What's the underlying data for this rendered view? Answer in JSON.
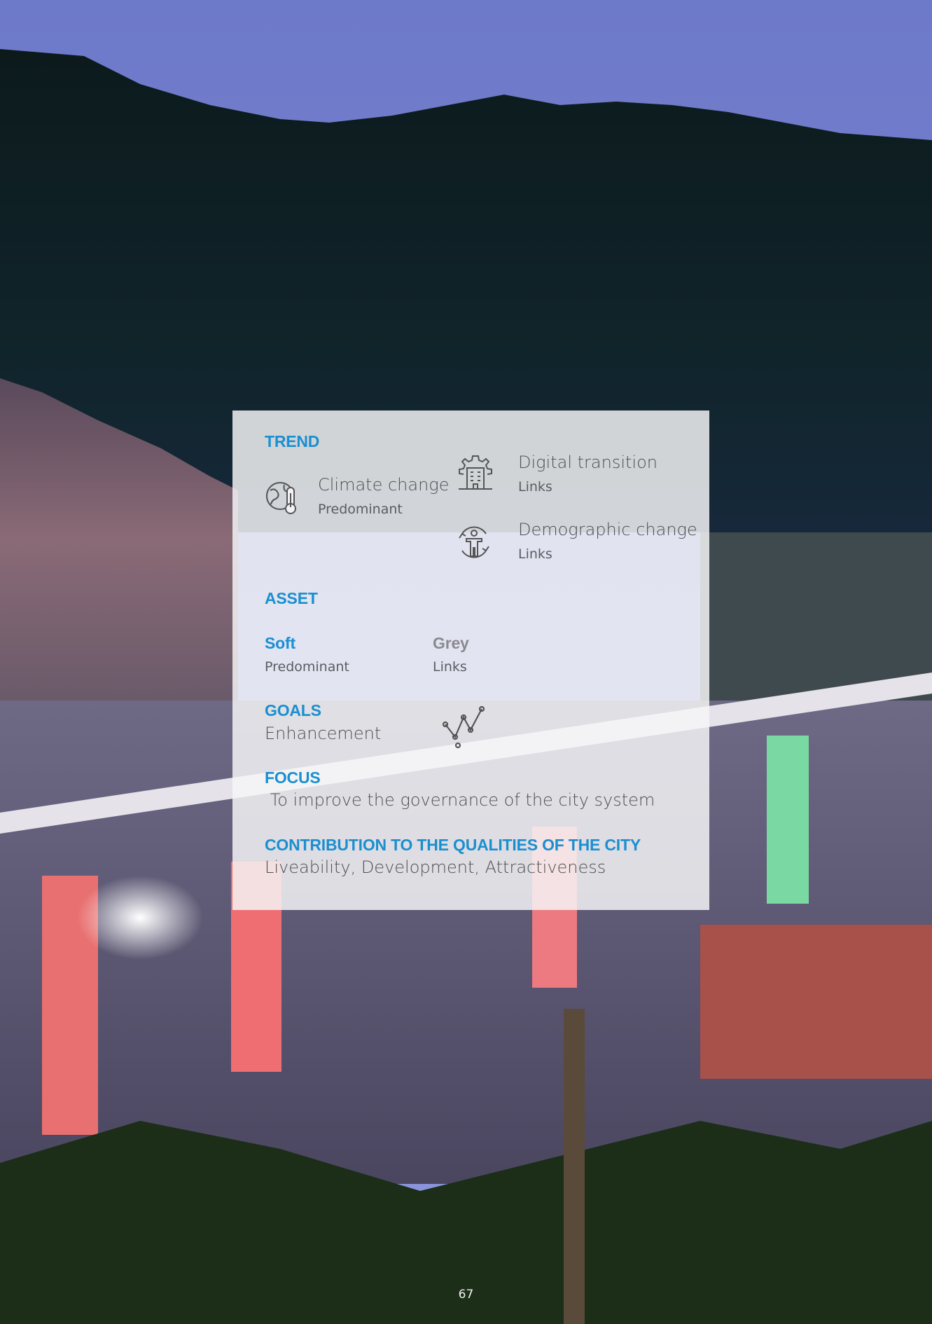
{
  "trend": {
    "heading": "TREND",
    "items": [
      {
        "icon": "climate-thermometer-icon",
        "title": "Climate change",
        "level": "Predominant"
      },
      {
        "icon": "digital-building-gear-icon",
        "title": "Digital transition",
        "level": "Links"
      },
      {
        "icon": "demographic-person-icon",
        "title": "Demographic change",
        "level": "Links"
      }
    ]
  },
  "asset": {
    "heading": "ASSET",
    "soft": {
      "title": "Soft",
      "level": "Predominant"
    },
    "grey": {
      "title": "Grey",
      "level": "Links"
    }
  },
  "goals": {
    "heading": "GOALS",
    "value": "Enhancement",
    "icon": "trend-line-chart-icon"
  },
  "focus": {
    "heading": "FOCUS",
    "value": " To improve the governance of the city system"
  },
  "contribution": {
    "heading": "CONTRIBUTION TO THE QUALITIES OF THE CITY",
    "value": "Liveability, Development, Attractiveness"
  },
  "page_number": "67",
  "colors": {
    "accent": "#1a8fd0",
    "grey_heading": "#8a8a8e"
  }
}
